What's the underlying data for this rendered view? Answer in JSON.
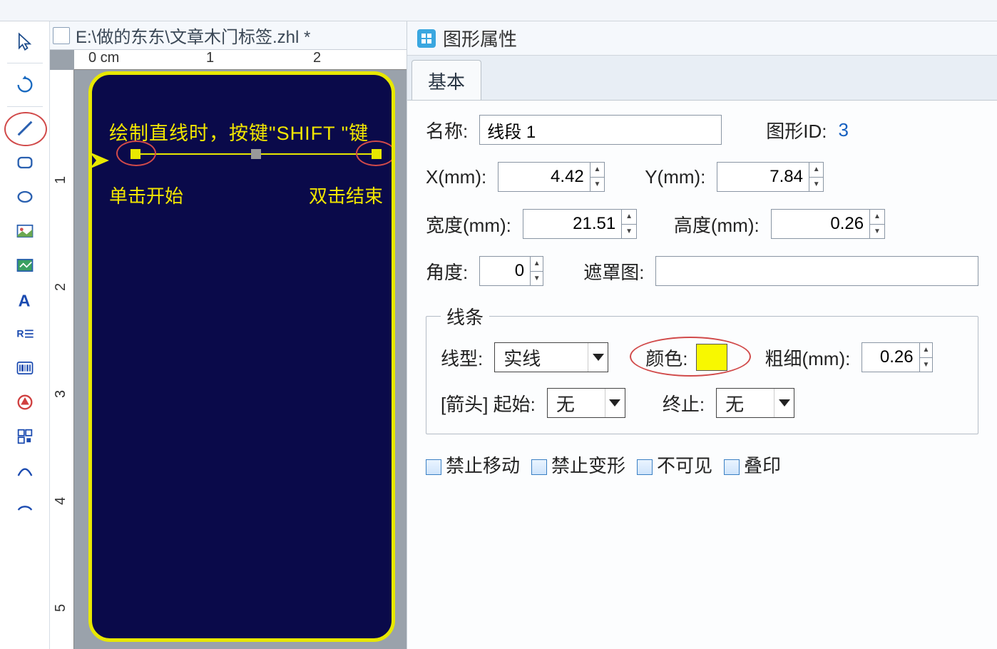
{
  "doc": {
    "title": "E:\\做的东东\\文章木门标签.zhl *"
  },
  "ruler": {
    "unit": "0 cm",
    "tick1": "1",
    "tick2": "2",
    "v1": "1",
    "v2": "2",
    "v3": "3",
    "v4": "4",
    "v5": "5"
  },
  "canvas": {
    "hint_line1": "绘制直线时，按键\"SHIFT \"键",
    "anno_start": "单击开始",
    "anno_end": "双击结束"
  },
  "panel": {
    "header": "图形属性",
    "tab_basic": "基本",
    "name_label": "名称:",
    "name_value": "线段 1",
    "id_label": "图形ID:",
    "id_value": "3",
    "x_label": "X(mm):",
    "x_value": "4.42",
    "y_label": "Y(mm):",
    "y_value": "7.84",
    "width_label": "宽度(mm):",
    "width_value": "21.51",
    "height_label": "高度(mm):",
    "height_value": "0.26",
    "angle_label": "角度:",
    "angle_value": "0",
    "mask_label": "遮罩图:",
    "line_group": "线条",
    "line_type_label": "线型:",
    "line_type_value": "实线",
    "color_label": "颜色:",
    "line_color": "#f8f800",
    "thickness_label": "粗细(mm):",
    "thickness_value": "0.26",
    "arrow_label": "[箭头] 起始:",
    "arrow_start_value": "无",
    "arrow_end_label": "终止:",
    "arrow_end_value": "无",
    "chk_no_move": "禁止移动",
    "chk_no_deform": "禁止变形",
    "chk_invisible": "不可见",
    "chk_overprint": "叠印"
  }
}
